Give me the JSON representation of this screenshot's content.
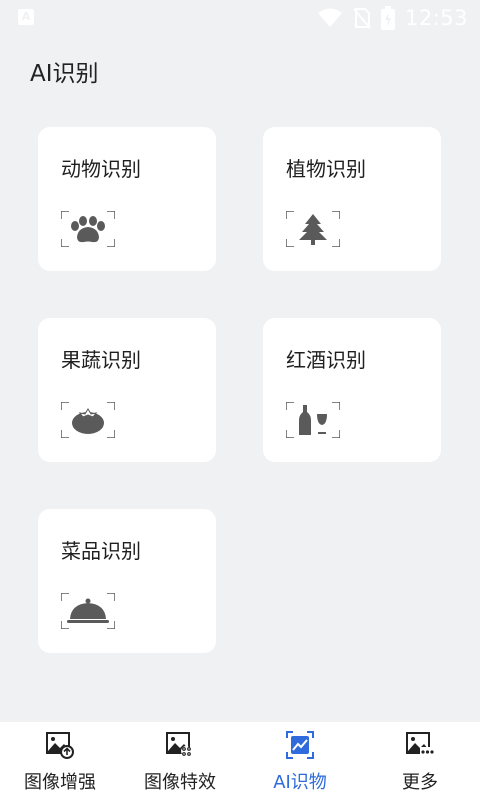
{
  "status": {
    "time": "12:53",
    "notification_glyph": "A"
  },
  "page": {
    "title": "AI识别"
  },
  "cards": [
    {
      "label": "动物识别",
      "icon": "paw-icon"
    },
    {
      "label": "植物识别",
      "icon": "tree-icon"
    },
    {
      "label": "果蔬识别",
      "icon": "tomato-icon"
    },
    {
      "label": "红酒识别",
      "icon": "wine-icon"
    },
    {
      "label": "菜品识别",
      "icon": "food-dome-icon"
    }
  ],
  "nav": {
    "items": [
      {
        "label": "图像增强",
        "icon": "image-enhance-icon"
      },
      {
        "label": "图像特效",
        "icon": "image-effects-icon"
      },
      {
        "label": "AI识物",
        "icon": "ai-recognize-icon",
        "active": true
      },
      {
        "label": "更多",
        "icon": "image-more-icon"
      }
    ]
  },
  "colors": {
    "accent": "#2f6bdc",
    "background": "#f0f1f3",
    "card": "#ffffff",
    "icon": "#5a5a5a"
  }
}
